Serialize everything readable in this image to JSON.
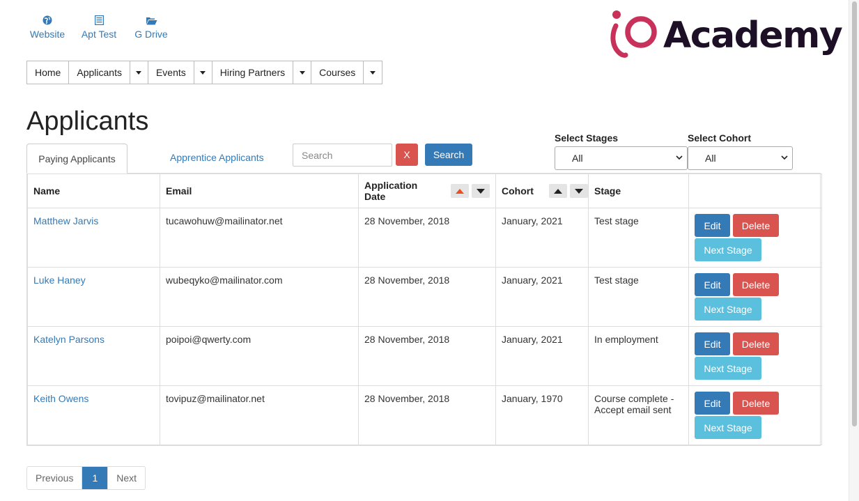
{
  "quick_links": {
    "website": "Website",
    "apt_test": "Apt Test",
    "g_drive": "G Drive"
  },
  "logo": {
    "text": "Academy",
    "mark_color": "#c8325a"
  },
  "nav": {
    "home": "Home",
    "applicants": "Applicants",
    "events": "Events",
    "hiring_partners": "Hiring Partners",
    "courses": "Courses"
  },
  "page_title": "Applicants",
  "tabs": {
    "paying": "Paying Applicants",
    "apprentice": "Apprentice Applicants"
  },
  "search": {
    "placeholder": "Search",
    "clear_label": "X",
    "button_label": "Search"
  },
  "filters": {
    "stages_label": "Select Stages",
    "stages_value": "All",
    "cohort_label": "Select Cohort",
    "cohort_value": "All"
  },
  "table": {
    "columns": [
      "Name",
      "Email",
      "Application Date",
      "Cohort",
      "Stage",
      ""
    ],
    "rows": [
      {
        "name": "Matthew Jarvis",
        "email": "tucawohuw@mailinator.net",
        "date": "28 November, 2018",
        "cohort": "January, 2021",
        "stage": "Test stage"
      },
      {
        "name": "Luke Haney",
        "email": "wubeqyko@mailinator.com",
        "date": "28 November, 2018",
        "cohort": "January, 2021",
        "stage": "Test stage"
      },
      {
        "name": "Katelyn Parsons",
        "email": "poipoi@qwerty.com",
        "date": "28 November, 2018",
        "cohort": "January, 2021",
        "stage": "In employment"
      },
      {
        "name": "Keith Owens",
        "email": "tovipuz@mailinator.net",
        "date": "28 November, 2018",
        "cohort": "January, 1970",
        "stage": "Course complete - Accept email sent"
      }
    ],
    "actions": {
      "edit": "Edit",
      "delete": "Delete",
      "next_stage": "Next Stage"
    }
  },
  "pagination": {
    "previous": "Previous",
    "current": "1",
    "next": "Next"
  },
  "colors": {
    "primary": "#337ab7",
    "danger": "#d9534f",
    "info": "#5bc0de",
    "sort_active": "#e8501f"
  }
}
